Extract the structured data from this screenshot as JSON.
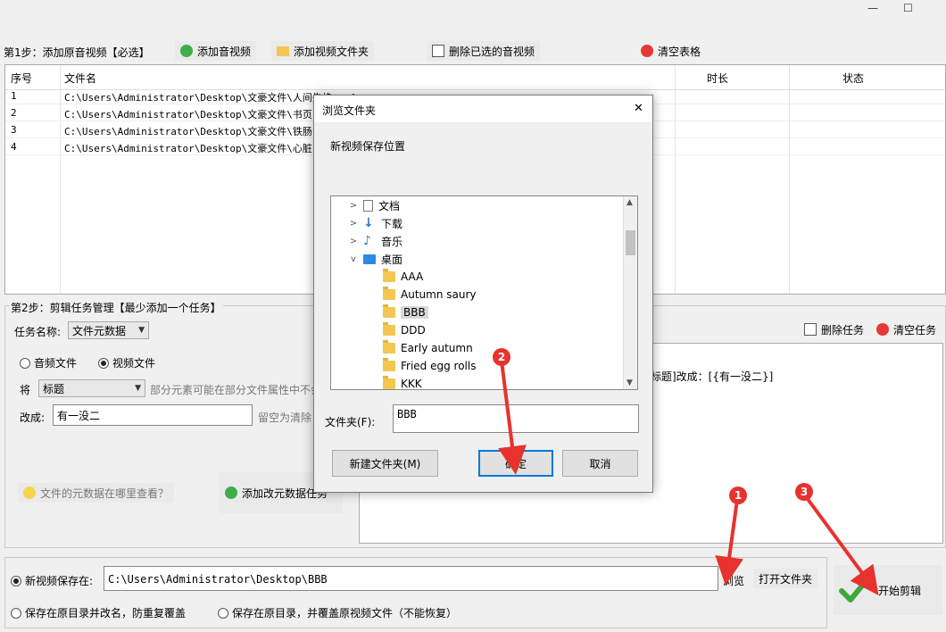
{
  "window": {
    "minimize": "—",
    "maximize": "☐"
  },
  "step1": {
    "label": "第1步：添加原音视频【必选】",
    "add_av": "添加音视频",
    "add_folder": "添加视频文件夹",
    "delete_selected": "删除已选的音视频",
    "clear_table": "清空表格"
  },
  "table": {
    "headers": {
      "index": "序号",
      "filename": "文件名",
      "duration": "时长",
      "status": "状态"
    },
    "rows": [
      {
        "index": "1",
        "filename": "C:\\Users\\Administrator\\Desktop\\文豪文件\\人间失格.mp4"
      },
      {
        "index": "2",
        "filename": "C:\\Users\\Administrator\\Desktop\\文豪文件\\书页.mp4"
      },
      {
        "index": "3",
        "filename": "C:\\Users\\Administrator\\Desktop\\文豪文件\\铁肠.mp4"
      },
      {
        "index": "4",
        "filename": "C:\\Users\\Administrator\\Desktop\\文豪文件\\心脏.mp4"
      }
    ]
  },
  "step2": {
    "label": "第2步：剪辑任务管理【最少添加一个任务】",
    "task_name_label": "任务名称:",
    "task_name_value": "文件元数据",
    "audio_file": "音频文件",
    "video_file": "视频文件",
    "jiang": "将",
    "field_value": "标题",
    "field_hint": "部分元素可能在部分文件属性中不会",
    "change_to": "改成:",
    "change_value": "有一没二",
    "change_hint": "留空为清除",
    "metadata_help": "文件的元数据在哪里查看？",
    "add_task": "添加改元数据任务",
    "delete_task": "删除任务",
    "clear_tasks": "清空任务",
    "task_line": "标题]改成：[{有一没二}]"
  },
  "output": {
    "save_new_label": "新视频保存在:",
    "save_path": "C:\\Users\\Administrator\\Desktop\\BBB",
    "browse": "浏览",
    "open_folder": "打开文件夹",
    "opt_rename": "保存在原目录并改名，防重复覆盖",
    "opt_overwrite": "保存在原目录，并覆盖原视频文件（不能恢复）",
    "start": "开始剪辑"
  },
  "dialog": {
    "title": "浏览文件夹",
    "close": "✕",
    "description": "新视频保存位置",
    "tree": [
      "文档",
      "下载",
      "音乐",
      "桌面",
      "AAA",
      "Autumn saury",
      "BBB",
      "DDD",
      "Early autumn",
      "Fried egg rolls",
      "KKK"
    ],
    "folder_label": "文件夹(F):",
    "folder_value": "BBB",
    "new_folder": "新建文件夹(M)",
    "ok": "确定",
    "cancel": "取消"
  },
  "markers": [
    "1",
    "2",
    "3"
  ],
  "colors": {
    "accent": "#0078d7",
    "marker": "#e8322d",
    "add_icon": "#3fae49",
    "clear_icon": "#e53935"
  }
}
